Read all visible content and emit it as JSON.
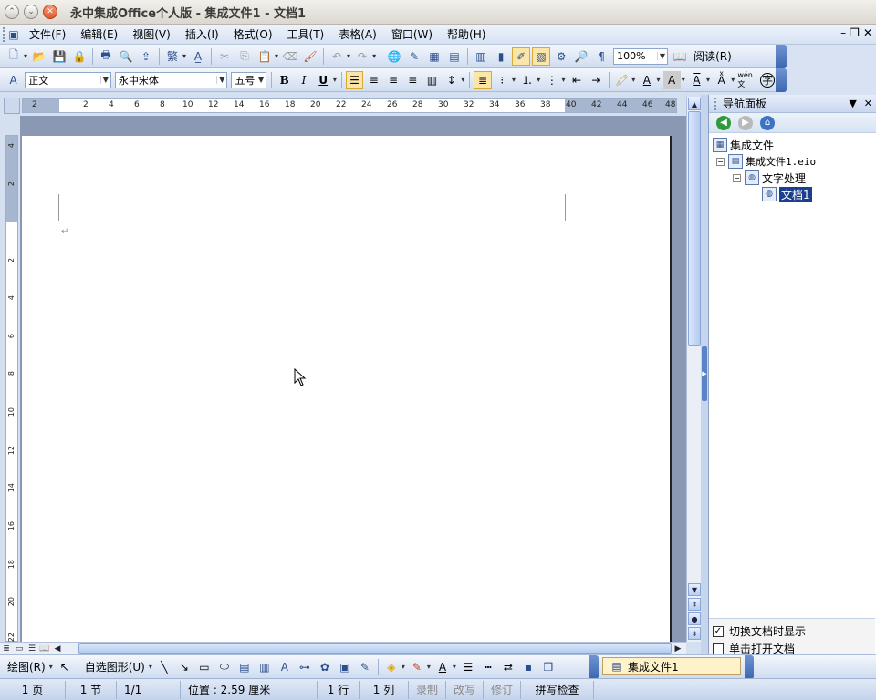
{
  "window": {
    "title": "永中集成Office个人版 - 集成文件1 - 文档1"
  },
  "menu": {
    "items": [
      "文件(F)",
      "编辑(E)",
      "视图(V)",
      "插入(I)",
      "格式(O)",
      "工具(T)",
      "表格(A)",
      "窗口(W)",
      "帮助(H)"
    ]
  },
  "toolbar": {
    "zoom": "100%",
    "read_label": "阅读(R)"
  },
  "format_bar": {
    "style": "正文",
    "font": "永中宋体",
    "size": "五号",
    "bold": "B",
    "italic": "I",
    "underline": "U",
    "pinyin_glyph": "wén 文",
    "circle_glyph": "字"
  },
  "ruler": {
    "h_ticks": [
      "2",
      "2",
      "4",
      "6",
      "8",
      "10",
      "12",
      "14",
      "16",
      "18",
      "20",
      "22",
      "24",
      "26",
      "28",
      "30",
      "32",
      "34",
      "36",
      "38",
      "40",
      "42",
      "44",
      "46",
      "48"
    ],
    "v_ticks": [
      "4",
      "2",
      "2",
      "4",
      "6",
      "8",
      "10",
      "12",
      "14",
      "16",
      "18",
      "20",
      "22"
    ]
  },
  "document": {
    "paragraph_mark": "↵"
  },
  "nav_panel": {
    "title": "导航面板",
    "tree": {
      "root": "集成文件",
      "file": "集成文件1.eio",
      "module": "文字处理",
      "doc": "文档1"
    },
    "options": [
      {
        "label": "切换文档时显示",
        "checked": true
      },
      {
        "label": "单击打开文档",
        "checked": false
      }
    ]
  },
  "draw_bar": {
    "draw_label": "绘图(R)",
    "autoshape_label": "自选图形(U)",
    "doc_tab": "集成文件1"
  },
  "status": {
    "page": "1 页",
    "section": "1 节",
    "pages": "1/1",
    "position": "位置 : 2.59 厘米",
    "line": "1 行",
    "column": "1 列",
    "record": "录制",
    "overwrite": "改写",
    "revise": "修订",
    "spellcheck": "拼写检查"
  }
}
